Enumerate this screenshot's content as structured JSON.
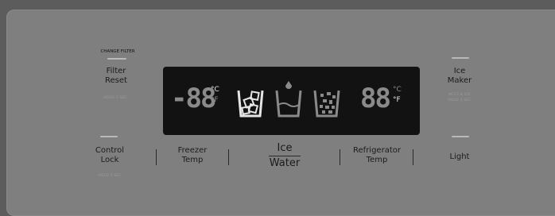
{
  "filter": {
    "top_label": "CHANGE FILTER",
    "label_line1": "Filter",
    "label_line2": "Reset",
    "hold": "HOLD 3 SEC"
  },
  "ice_maker": {
    "label_line1": "Ice",
    "label_line2": "Maker",
    "sub1": "ACCS & ICE",
    "sub2": "HOLD 3 SEC"
  },
  "control_lock": {
    "label_line1": "Control",
    "label_line2": "Lock",
    "hold": "HOLD 3 SEC"
  },
  "freezer": {
    "label_line1": "Freezer",
    "label_line2": "Temp"
  },
  "ice_water": {
    "label_line1": "Ice",
    "label_line2": "Water"
  },
  "refrigerator": {
    "label_line1": "Refrigerator",
    "label_line2": "Temp"
  },
  "light": {
    "label": "Light"
  },
  "display": {
    "left_temp": "-88",
    "left_unit_c": "°C",
    "left_unit_f": "°F",
    "right_temp": "88",
    "right_unit_c": "°C",
    "right_unit_f": "°F",
    "active_color": "#e6e6e6",
    "dim_color": "#8a8a8a"
  }
}
